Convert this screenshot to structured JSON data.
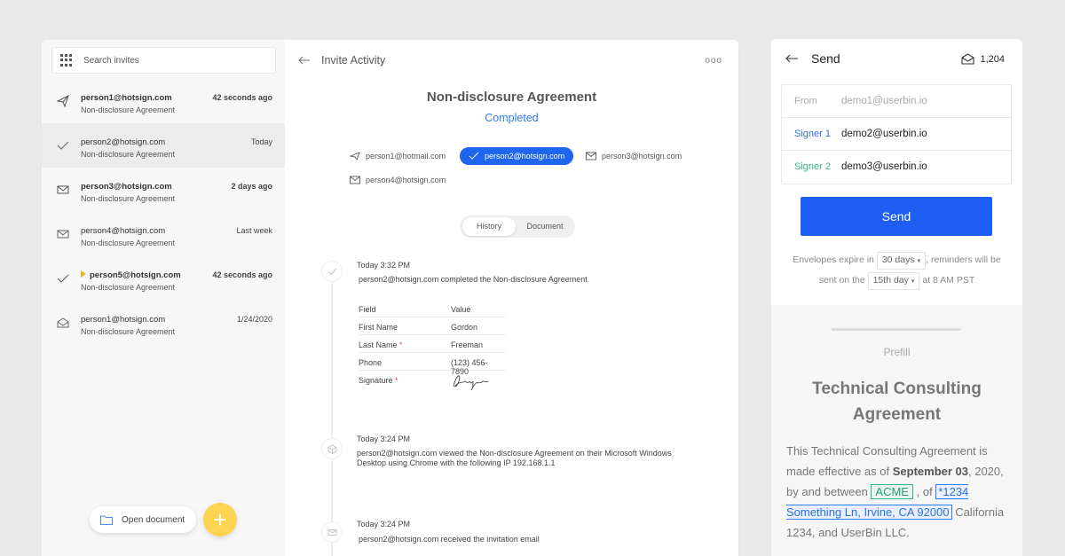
{
  "sidebar": {
    "search_placeholder": "Search invites",
    "invites": [
      {
        "email": "person1@hotsign.com",
        "document": "Non-disclosure Agreement",
        "time": "42 seconds ago",
        "icon": "paper-plane-icon",
        "bold": true,
        "selected": false,
        "flag": false
      },
      {
        "email": "person2@hotsign.com",
        "document": "Non-disclosure Agreement",
        "time": "Today",
        "icon": "checkmark-icon",
        "bold": false,
        "selected": true,
        "flag": false
      },
      {
        "email": "person3@hotsign.com",
        "document": "Non-disclosure Agreement",
        "time": "2 days ago",
        "icon": "envelope-icon",
        "bold": true,
        "selected": false,
        "flag": false
      },
      {
        "email": "person4@hotsign.com",
        "document": "Non-disclosure Agreement",
        "time": "Last week",
        "icon": "envelope-icon",
        "bold": false,
        "selected": false,
        "flag": false
      },
      {
        "email": "person5@hotsign.com",
        "document": "Non-disclosure Agreement",
        "time": "42 seconds ago",
        "icon": "checkmark-icon",
        "bold": true,
        "selected": false,
        "flag": true
      },
      {
        "email": "person1@hotsign.com",
        "document": "Non-disclosure Agreement",
        "time": "1/24/2020",
        "icon": "envelope-open-icon",
        "bold": false,
        "selected": false,
        "flag": false
      }
    ],
    "open_document_label": "Open document",
    "fab_label": "+"
  },
  "main": {
    "header_title": "Invite Activity",
    "more_label": "ooo",
    "doc_title": "Non-disclosure Agreement",
    "doc_status": "Completed",
    "recipients": [
      {
        "email": "person1@hotmail.com",
        "icon": "paper-plane-icon"
      },
      {
        "email": "person2@hotsign.com",
        "icon": "checkmark-icon"
      },
      {
        "email": "person3@hotsign.com",
        "icon": "envelope-icon"
      },
      {
        "email": "person4@hotsign.com",
        "icon": "envelope-icon"
      }
    ],
    "tabs": {
      "history": "History",
      "document": "Document"
    },
    "events": [
      {
        "time": "Today 3:32 PM",
        "text": "person2@hotsign.com completed the Non-disclosure Agreement",
        "icon": "checkmark-icon"
      },
      {
        "time": "Today 3:24 PM",
        "text": "person2@hotsign.com viewed the Non-disclosure Agreement on their Microsoft Windows Desktop using Chrome with the following IP 192.168.1.1",
        "icon": "cube-icon"
      },
      {
        "time": "Today 3:24 PM",
        "text": "person2@hotsign.com received the invitation email",
        "icon": "envelope-icon"
      }
    ],
    "fields": {
      "header": {
        "field": "Field",
        "value": "Value"
      },
      "rows": [
        {
          "field": "First Name",
          "value": "Gordon",
          "required": ""
        },
        {
          "field": "Last Name",
          "value": "Freeman",
          "required": "*"
        },
        {
          "field": "Phone",
          "value": "(123) 456-7890",
          "required": ""
        },
        {
          "field": "Signature",
          "value": "",
          "required": "*"
        }
      ]
    }
  },
  "send_panel": {
    "title": "Send",
    "envelope_count": "1,204",
    "from_label": "From",
    "from_value": "demo1@userbin.io",
    "signers": [
      {
        "label": "Signer 1",
        "email": "demo2@userbin.io",
        "color": "#2e6fe0"
      },
      {
        "label": "Signer 2",
        "email": "demo3@userbin.io",
        "color": "#3ab38a"
      }
    ],
    "send_label": "Send",
    "expire_text_1": "Envelopes expire in",
    "expire_value": "30 days",
    "expire_text_2": ", reminders will be",
    "expire_text_3": "sent on the",
    "reminder_value": "15th day",
    "expire_text_4": "at 8 AM PST",
    "prefill_label": "Prefill",
    "prefill_title": "Technical Consulting Agreement",
    "body_1": "This Technical Consulting Agreement is made effective as of",
    "body_date": "September 03",
    "body_2": ", 2020, by and between",
    "body_acme": "ACME",
    "body_3": ", of",
    "body_address": "*1234 Something Ln, Irvine, CA 92000",
    "body_4": "California 1234, and UserBin LLC."
  },
  "colors": {
    "accent": "#1f5ef5",
    "fab": "#fcd452",
    "status": "#2e7bf2"
  }
}
